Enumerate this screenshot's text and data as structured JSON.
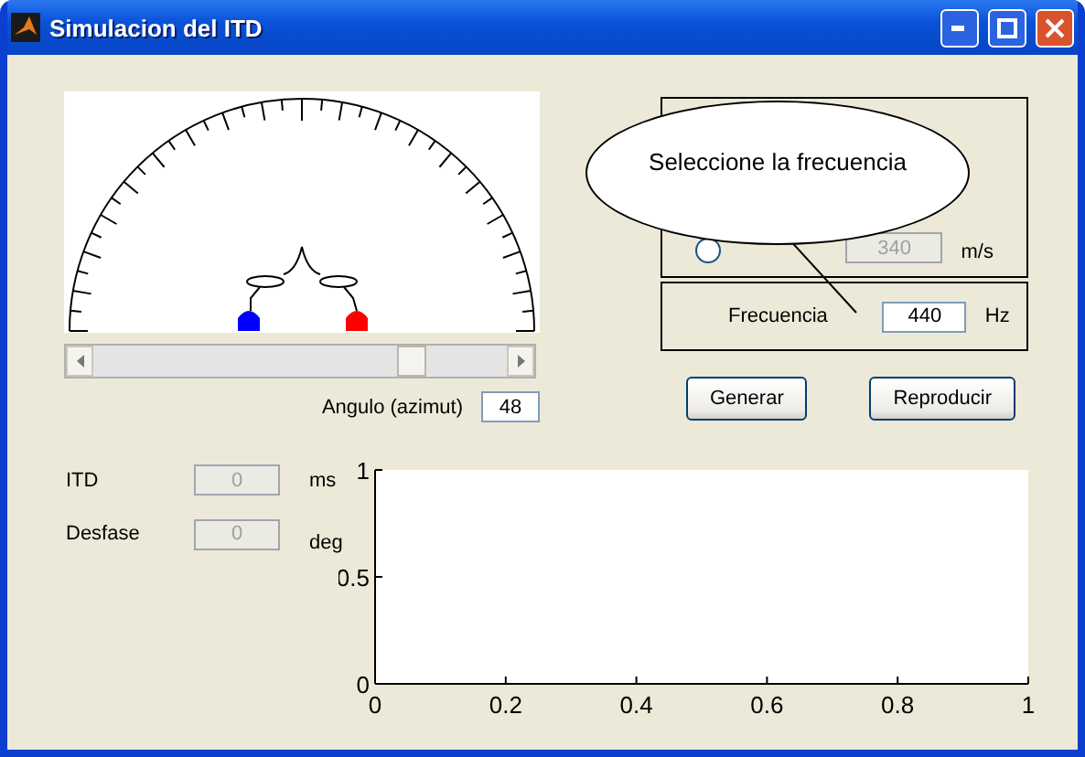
{
  "window": {
    "title": "Simulacion del ITD"
  },
  "azimuth": {
    "level": 0.77,
    "label": "Angulo (azimut)",
    "value": "48"
  },
  "speed_panel": {
    "radio": {
      "selected": false
    },
    "value": "340",
    "unit": "m/s",
    "disabled": true
  },
  "frequency_panel": {
    "label": "Frecuencia",
    "value": "440",
    "unit": "Hz"
  },
  "buttons": [
    "Generar",
    "Reproducir"
  ],
  "results": [
    {
      "label": "ITD",
      "value": "0",
      "unit": "ms",
      "disabled": true
    },
    {
      "label": "Desfase",
      "value": "0",
      "unit": "deg",
      "disabled": true
    }
  ],
  "callout": {
    "text": "Seleccione la frecuencia"
  },
  "plot": {
    "chart_data": {
      "type": "line",
      "xlim": [
        0,
        1
      ],
      "ylim": [
        0,
        1
      ],
      "xticks": [
        0,
        0.2,
        0.4,
        0.6,
        0.8,
        1
      ],
      "yticks": [
        0,
        0.5,
        1
      ]
    }
  }
}
